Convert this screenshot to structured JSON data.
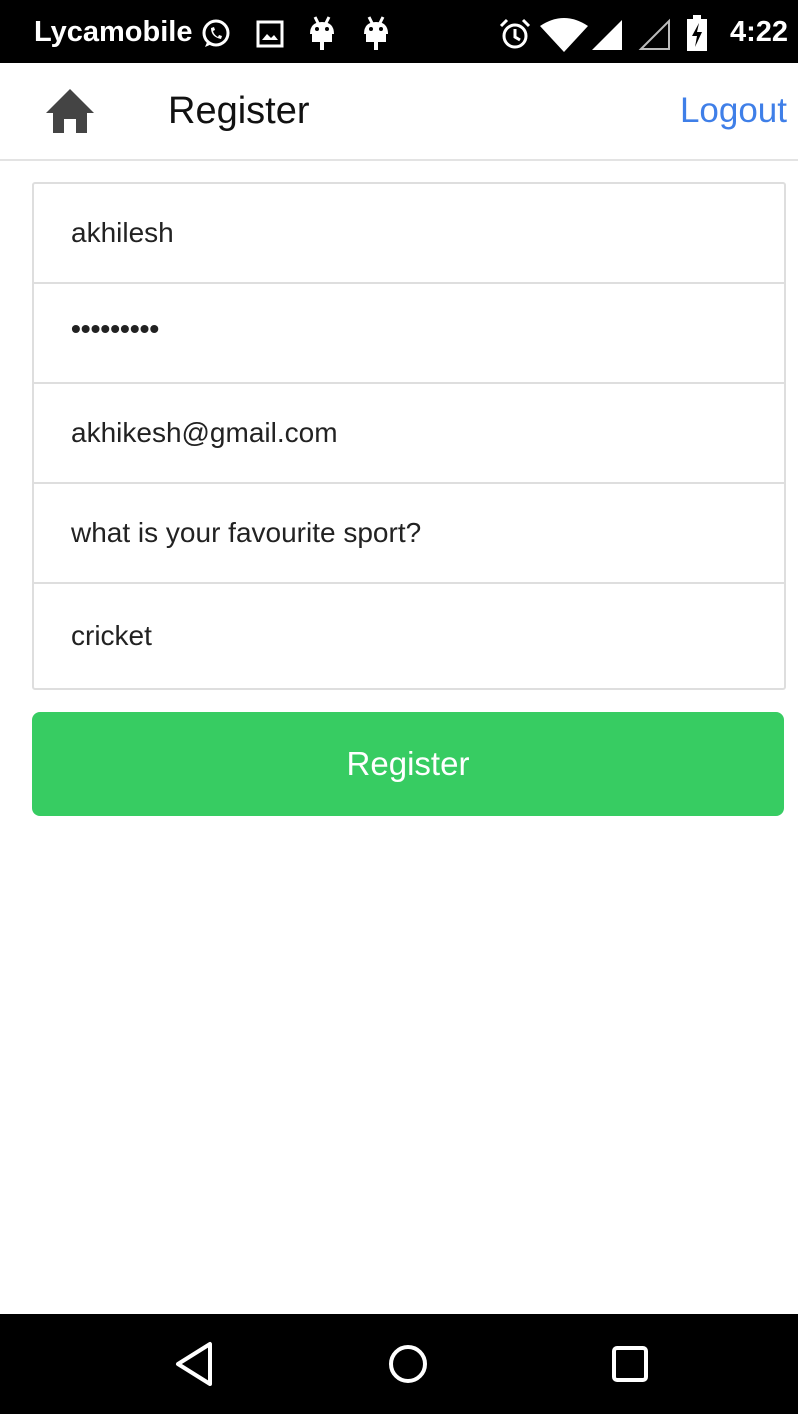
{
  "status_bar": {
    "carrier": "Lycamobile",
    "time": "4:22",
    "icons": [
      "whatsapp-icon",
      "image-notification-icon",
      "android-debug-icon",
      "android-debug-icon",
      "alarm-icon",
      "wifi-icon",
      "signal-icon",
      "signal-empty-icon",
      "battery-charging-icon"
    ]
  },
  "app_bar": {
    "home_icon": "home-icon",
    "title": "Register",
    "logout_label": "Logout"
  },
  "form": {
    "fields": [
      {
        "name": "username",
        "value": "akhilesh"
      },
      {
        "name": "password",
        "value": "•••••••••"
      },
      {
        "name": "email",
        "value": "akhikesh@gmail.com"
      },
      {
        "name": "security_question",
        "value": "what is your favourite sport?"
      },
      {
        "name": "security_answer",
        "value": "cricket"
      }
    ],
    "submit_label": "Register"
  },
  "nav_bar": {
    "icons": [
      "back-icon",
      "home-circle-icon",
      "recents-icon"
    ]
  },
  "colors": {
    "accent_link": "#3f7fe8",
    "register_button": "#37cc62",
    "status_bar": "#000000"
  }
}
